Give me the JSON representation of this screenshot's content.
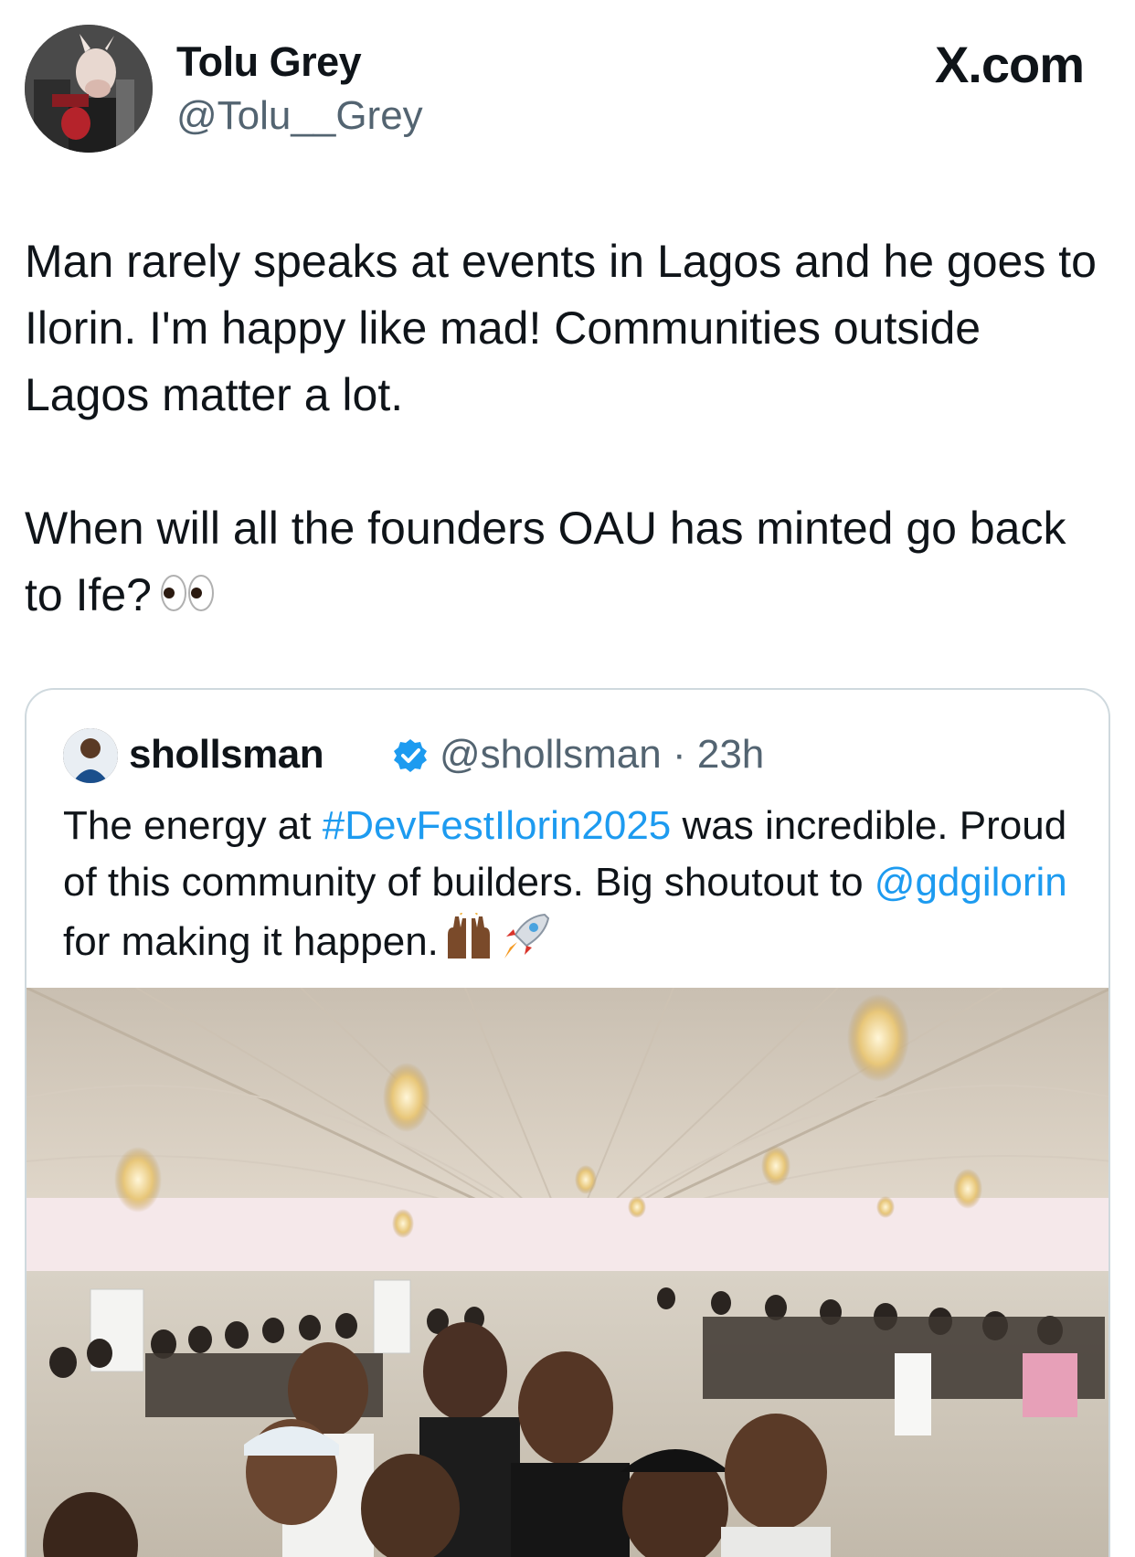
{
  "author": {
    "name": "Tolu Grey",
    "handle": "@Tolu__Grey"
  },
  "brand": {
    "label": "X.com"
  },
  "tweet": {
    "line1": "Man rarely speaks at events in Lagos and he goes to Ilorin. I'm happy like mad! Communities outside Lagos matter a lot.",
    "line2": "When will all the founders OAU has minted go back to Ife?",
    "emoji": "eyes-icon"
  },
  "quoted": {
    "name": "shollsman",
    "handle_time": "@shollsman · 23h",
    "text_part1": "The energy at ",
    "hashtag": "#DevFestIlorin2025",
    "text_part2": " was incredible. Proud of this community of builders. Big shoutout to ",
    "mention": "@gdgilorin",
    "text_part3": " for making it happen.",
    "emojis": [
      "raising-hands-icon",
      "rocket-icon"
    ]
  },
  "colors": {
    "text": "#0f1419",
    "secondary": "#536471",
    "link": "#1d9bf0",
    "border": "#cfd9de"
  }
}
